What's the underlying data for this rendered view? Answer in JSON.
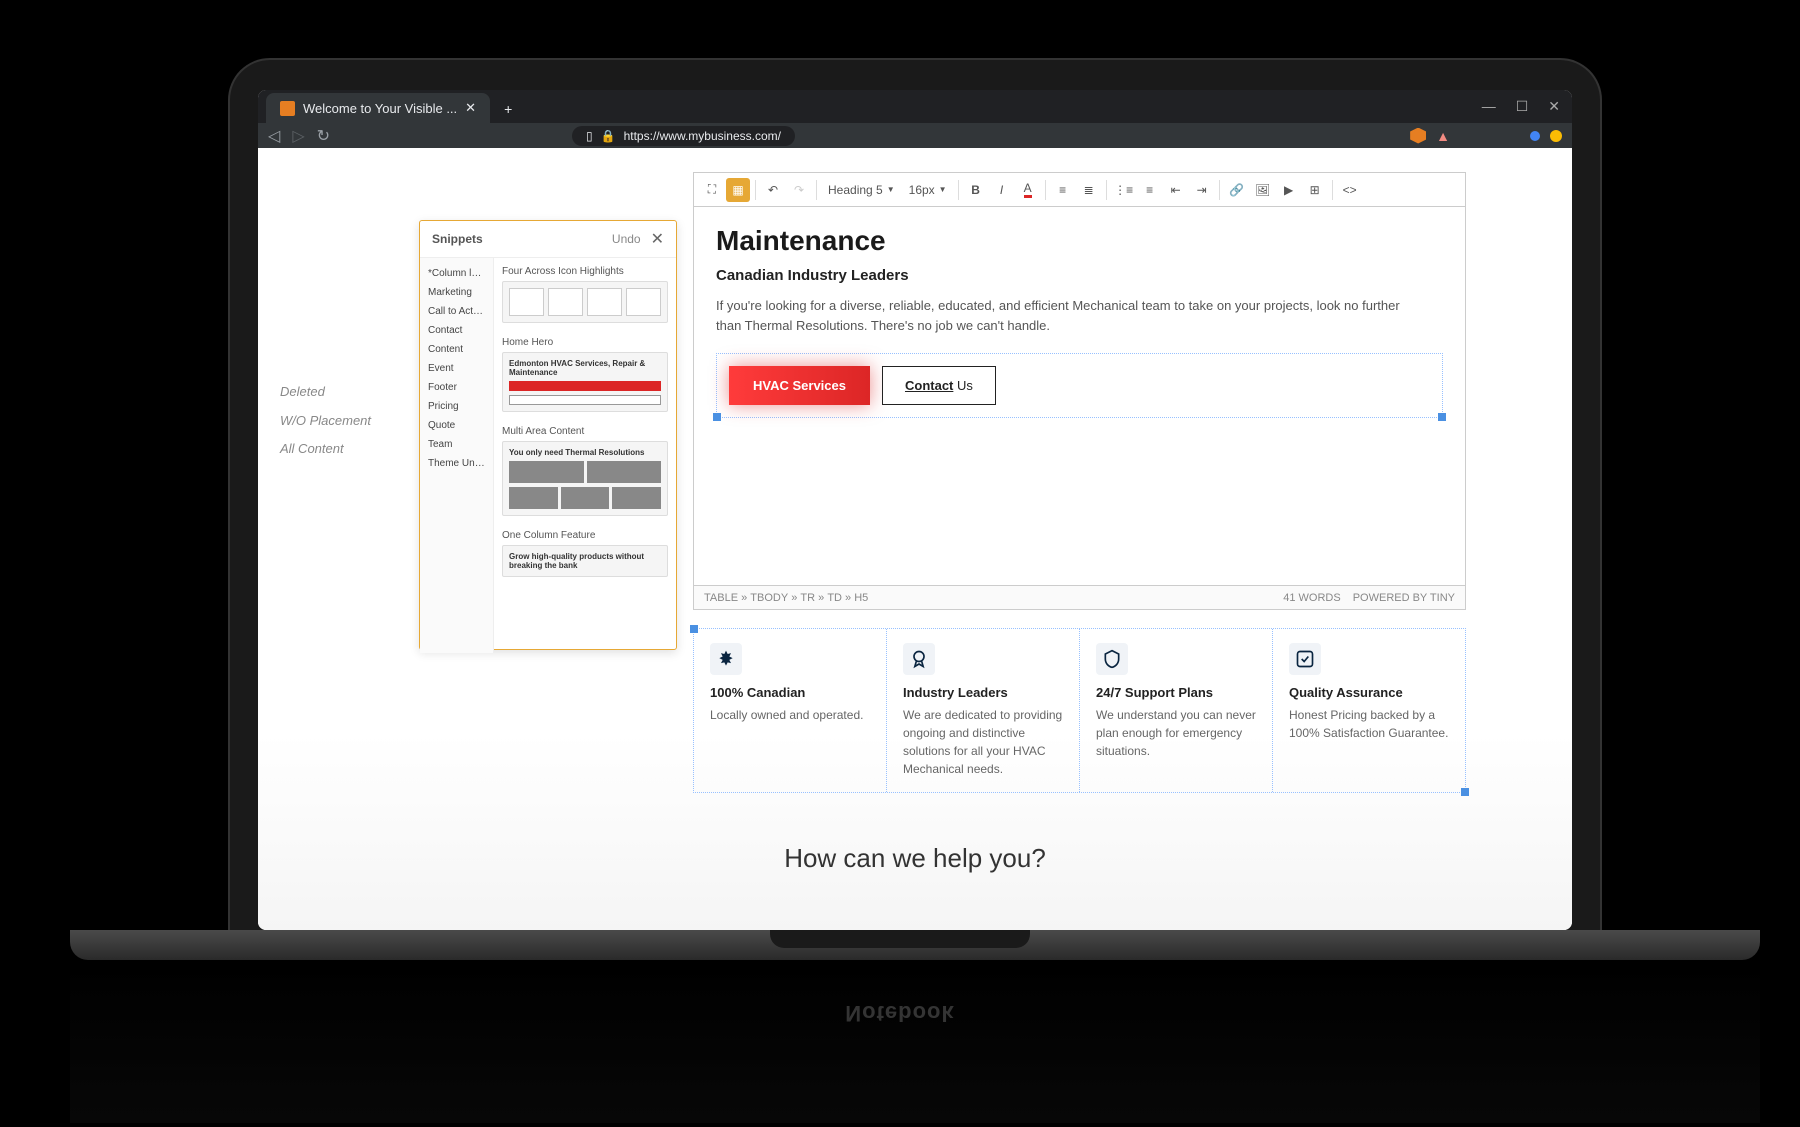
{
  "browser": {
    "tab_title": "Welcome to Your Visible ...",
    "url": "https://www.mybusiness.com/",
    "window": {
      "min": "—",
      "max": "☐",
      "close": "✕"
    }
  },
  "left_sidebar": [
    "Deleted",
    "W/O Placement",
    "All Content"
  ],
  "snippets": {
    "title": "Snippets",
    "undo": "Undo",
    "categories": [
      "*Column layouts",
      "Marketing",
      "Call to Action",
      "Contact",
      "Content",
      "Event",
      "Footer",
      "Pricing",
      "Quote",
      "Team",
      "Theme Unicomme"
    ],
    "previews": {
      "four_across": {
        "title": "Four Across Icon Highlights"
      },
      "home_hero": {
        "title": "Home Hero",
        "heading": "Edmonton HVAC Services, Repair & Maintenance"
      },
      "multi_area": {
        "title": "Multi Area Content",
        "heading": "You only need Thermal Resolutions"
      },
      "one_column": {
        "title": "One Column Feature",
        "heading": "Grow high-quality products without breaking the bank"
      }
    }
  },
  "toolbar": {
    "heading_select": "Heading 5",
    "size_select": "16px"
  },
  "content": {
    "page_title_visible": "Maintenance",
    "sub_heading": "Canadian Industry Leaders",
    "body": "If you're looking for a diverse, reliable, educated, and efficient Mechanical team to take on your projects, look no further than Thermal Resolutions. There's no job we can't handle.",
    "btn_primary": "HVAC Services",
    "btn_outline_a": "Contact",
    "btn_outline_b": " Us"
  },
  "editor_footer": {
    "path": [
      "TABLE",
      "TBODY",
      "TR",
      "TD",
      "H5"
    ],
    "word_count": "41 WORDS",
    "powered": "POWERED BY TINY"
  },
  "features": [
    {
      "icon": "leaf",
      "title": "100% Canadian",
      "text": "Locally owned and operated."
    },
    {
      "icon": "badge",
      "title": "Industry Leaders",
      "text": "We are dedicated to providing ongoing and distinctive solutions for all your HVAC Mechanical needs."
    },
    {
      "icon": "shield",
      "title": "24/7 Support Plans",
      "text": "We understand you can never plan enough for emergency situations."
    },
    {
      "icon": "check",
      "title": "Quality Assurance",
      "text": "Honest Pricing backed by a 100% Satisfaction Guarantee."
    }
  ],
  "help_heading": "How can we help you?",
  "notebook_label": "Notebook"
}
